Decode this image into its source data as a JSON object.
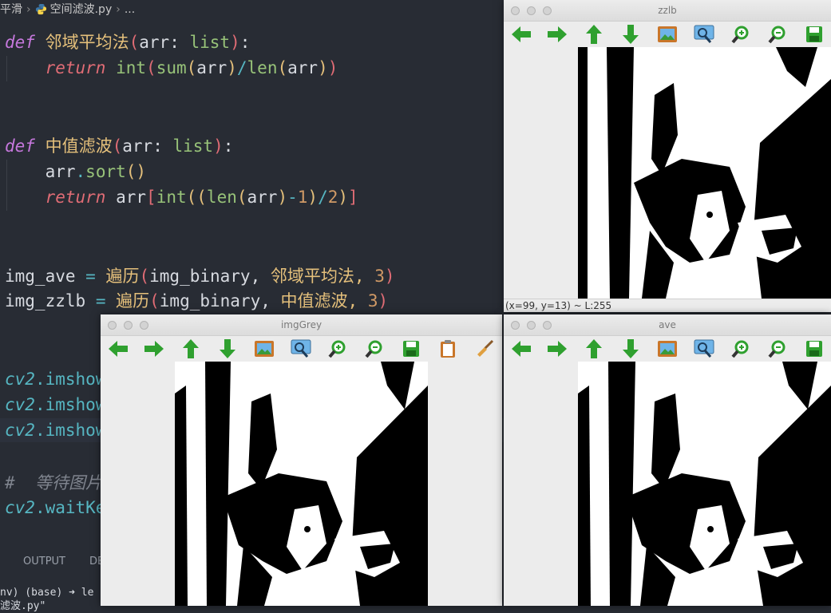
{
  "editor": {
    "breadcrumb": {
      "folder": "平滑",
      "file": "空间滤波.py",
      "ellipsis": "..."
    },
    "lines": {
      "l1": {
        "kw": "def",
        "name": "邻域平均法",
        "p1": "(",
        "arg": "arr",
        "colon": ":",
        "type": "list",
        "p2": ")",
        "end": ":"
      },
      "l2": {
        "kw": "return",
        "call": "int",
        "p1": "(",
        "sum": "sum",
        "p2": "(",
        "arg": "arr",
        "p3": ")",
        "op": "/",
        "len": "len",
        "p4": "(",
        "arg2": "arr",
        "p5": ")",
        "p6": ")"
      },
      "l3": {
        "kw": "def",
        "name": "中值滤波",
        "p1": "(",
        "arg": "arr",
        "colon": ":",
        "type": "list",
        "p2": ")",
        "end": ":"
      },
      "l4": {
        "obj": "arr",
        "dot": ".",
        "method": "sort",
        "parens": "()"
      },
      "l5": {
        "kw": "return",
        "obj": "arr",
        "b1": "[",
        "call": "int",
        "p1": "((",
        "len": "len",
        "p2": "(",
        "arg": "arr",
        "p3": ")",
        "minus": "-",
        "one": "1",
        "p4": ")",
        "div": "/",
        "two": "2",
        "p5": ")",
        "b2": "]"
      },
      "l6": {
        "var": "img_ave",
        "eq": "=",
        "fn": "遍历",
        "p1": "(",
        "a1": "img_binary,",
        "a2": "邻域平均法,",
        "n": "3",
        "p2": ")"
      },
      "l7": {
        "var": "img_zzlb",
        "eq": "=",
        "fn": "遍历",
        "p1": "(",
        "a1": "img_binary,",
        "a2": "中值滤波,",
        "n": "3",
        "p2": ")"
      },
      "l8": {
        "mod": "cv2",
        "dot": ".",
        "frag": "imshow"
      },
      "l9": {
        "mod": "cv2",
        "dot": ".",
        "frag": "imshow"
      },
      "l10": {
        "mod": "cv2",
        "dot": ".",
        "frag": "imshow"
      },
      "l11": {
        "hash": "#",
        "text": "等待图片"
      },
      "l12": {
        "mod": "cv2",
        "dot": ".",
        "frag": "waitKe"
      }
    },
    "panel_tabs": {
      "output": "OUTPUT",
      "second": "DE"
    },
    "terminal": {
      "line1": "nv) (base) ➜  le",
      "line2": "滤波.py\""
    }
  },
  "windows": {
    "zzlb": {
      "title": "zzlb",
      "status": "(x=99, y=13) ~ L:255"
    },
    "imgGrey": {
      "title": "imgGrey"
    },
    "ave": {
      "title": "ave"
    }
  },
  "toolbar_icons": [
    "arrow-left-icon",
    "arrow-right-icon",
    "arrow-up-icon",
    "arrow-down-icon",
    "picture-icon",
    "zoom-fit-icon",
    "zoom-in-icon",
    "zoom-out-icon",
    "save-icon",
    "clipboard-icon",
    "brush-icon"
  ],
  "colors": {
    "editor_bg": "#282c34",
    "keyword": "#c678dd",
    "function": "#e5c07b",
    "builtin": "#98c379",
    "number": "#d19a66",
    "toolbar_green": "#2fa02f"
  }
}
